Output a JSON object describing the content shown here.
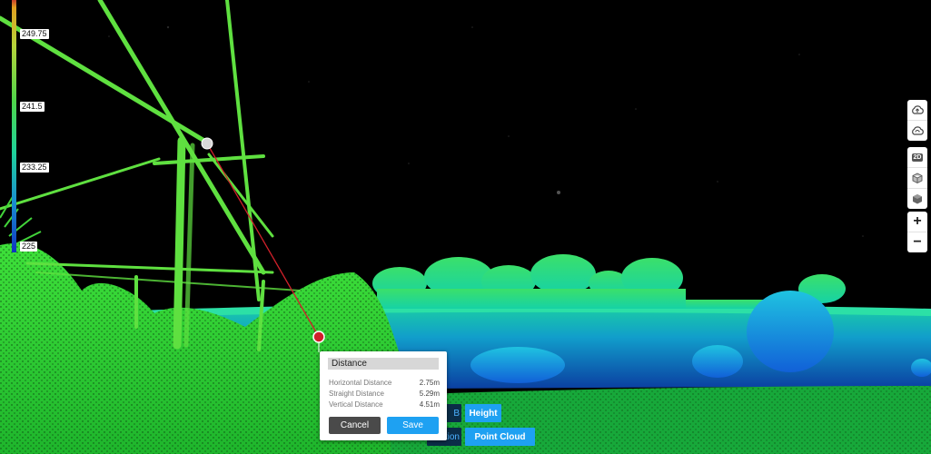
{
  "legend": {
    "labels": [
      "249.75",
      "241.5",
      "233.25",
      "225"
    ]
  },
  "measurement": {
    "title": "Distance",
    "rows": [
      {
        "label": "Horizontal Distance",
        "value": "2.75m"
      },
      {
        "label": "Straight Distance",
        "value": "5.29m"
      },
      {
        "label": "Vertical Distance",
        "value": "4.51m"
      }
    ],
    "cancel_label": "Cancel",
    "save_label": "Save"
  },
  "color_modes": {
    "rgb_partial": "B",
    "height": "Height",
    "classification_partial": "ation",
    "point_cloud": "Point Cloud"
  },
  "toolbar": {
    "view_2d": "2D",
    "zoom_in": "+",
    "zoom_out": "−",
    "icons": [
      "cloud-upload-icon",
      "cloud-sync-icon",
      "view-2d-icon",
      "cube-outline-icon",
      "cube-solid-icon",
      "zoom-in-icon",
      "zoom-out-icon"
    ]
  },
  "colors": {
    "accent": "#1ea1f2",
    "measure_line": "#d0202a"
  }
}
